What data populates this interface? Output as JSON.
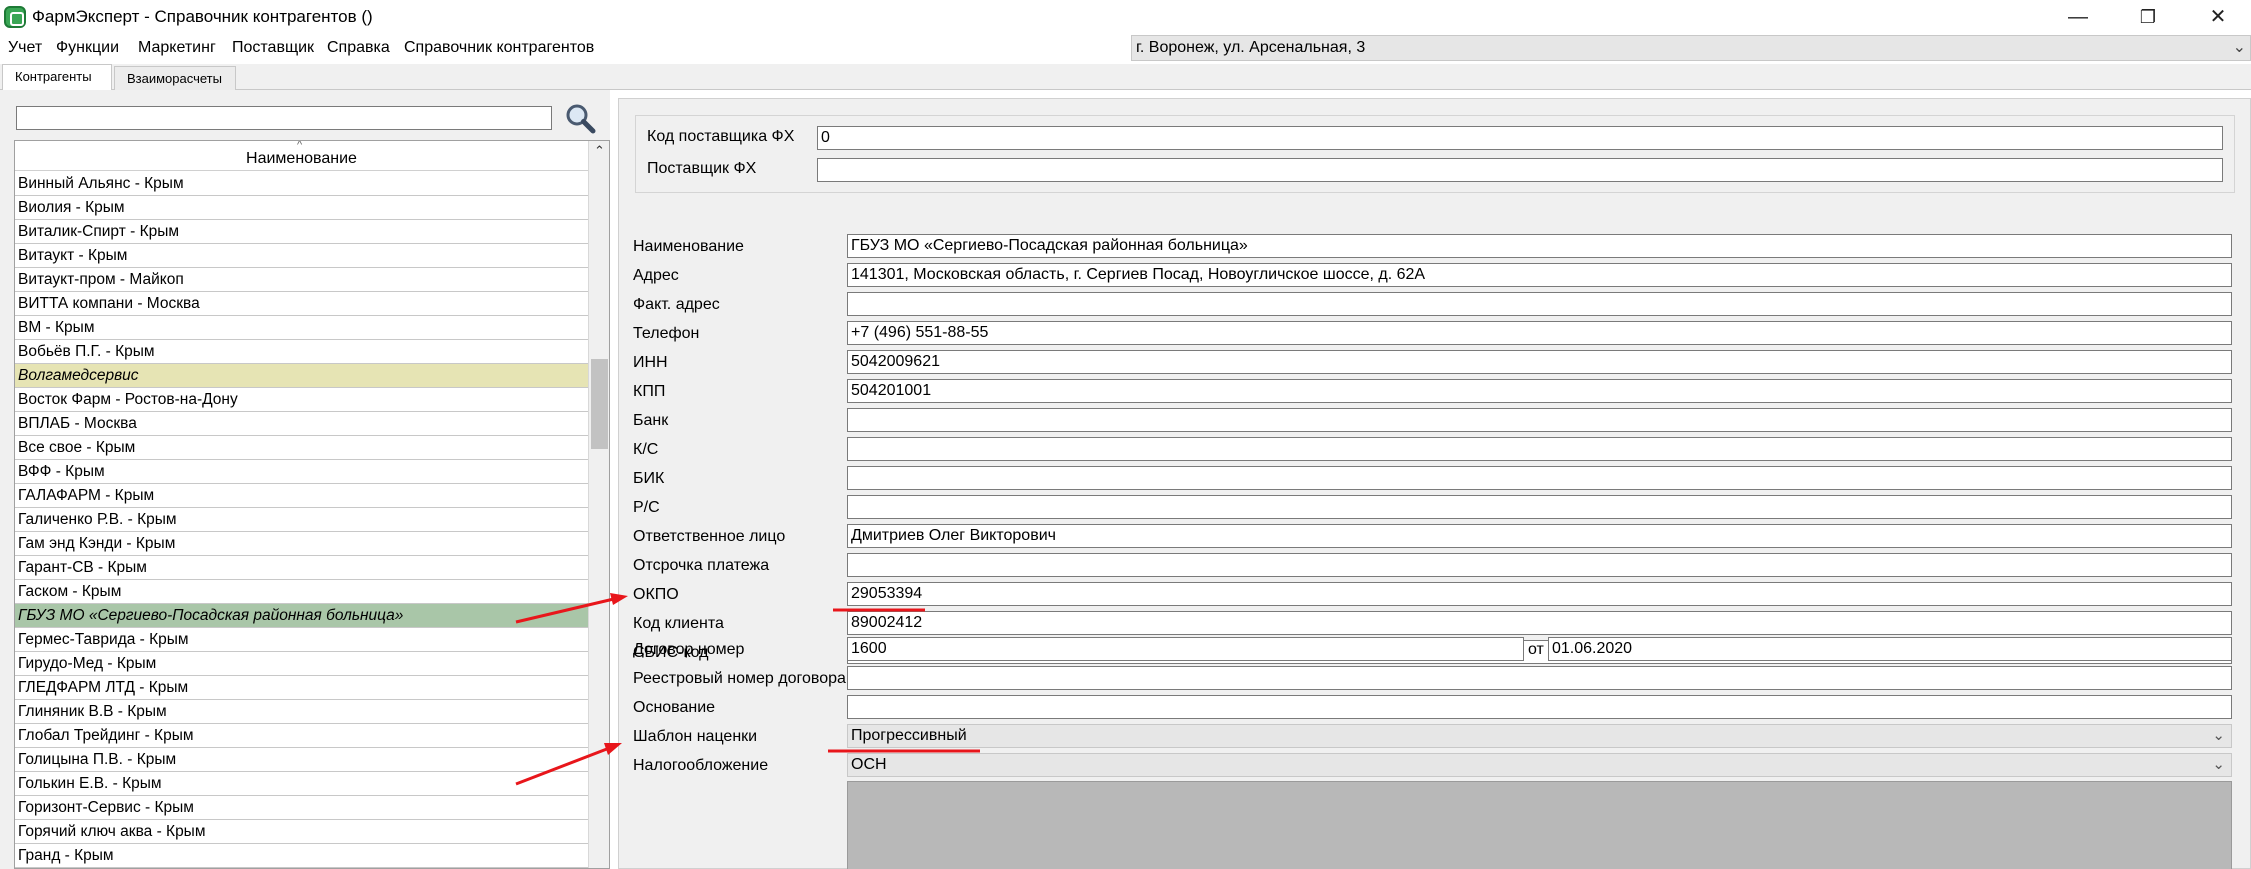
{
  "window": {
    "title": "ФармЭксперт - Справочник контрагентов ()",
    "minimize": "—",
    "restore": "❐",
    "close": "✕"
  },
  "menu": {
    "items": [
      "Учет",
      "Функции",
      "Маркетинг",
      "Поставщик",
      "Справка",
      "Справочник контрагентов"
    ],
    "location": "г. Воронеж, ул. Арсенальная, 3"
  },
  "tabs": [
    "Контрагенты",
    "Взаиморасчеты"
  ],
  "search": {
    "value": "",
    "placeholder": ""
  },
  "list": {
    "header": "Наименование",
    "rows": [
      "Винный Альянс - Крым",
      "Виолия - Крым",
      "Виталик-Спирт - Крым",
      "Витаукт - Крым",
      "Витаукт-пром - Майкоп",
      "ВИТТА компани - Москва",
      "ВМ - Крым",
      "Вобьёв П.Г. - Крым",
      "Волгамедсервис",
      "Восток Фарм - Ростов-на-Дону",
      "ВПЛАБ - Москва",
      "Все свое - Крым",
      "ВФФ - Крым",
      "ГАЛАФАРМ - Крым",
      "Галиченко Р.В. - Крым",
      "Гам энд Кэнди - Крым",
      "Гарант-СВ - Крым",
      "Гаском - Крым",
      "ГБУЗ МО «Сергиево-Посадская районная больница»",
      "Гермес-Таврида - Крым",
      "Гирудо-Мед - Крым",
      "ГЛЕДФАРМ ЛТД - Крым",
      "Глиняник В.В - Крым",
      "Глобал Трейдинг - Крым",
      "Голицына П.В. - Крым",
      "Голькин Е.В. - Крым",
      "Горизонт-Сервис - Крым",
      "Горячий ключ аква - Крым",
      "Гранд - Крым"
    ],
    "group_row_index": 8,
    "selected_row_index": 18
  },
  "form": {
    "fx_code_label": "Код поставщика ФХ",
    "fx_code_value": "0",
    "fx_supplier_label": "Поставщик ФХ",
    "fx_supplier_value": "",
    "fields": [
      {
        "label": "Наименование",
        "value": "ГБУЗ МО «Сергиево-Посадская районная больница»"
      },
      {
        "label": "Адрес",
        "value": "141301, Московская область, г. Сергиев Посад, Новоугличское шоссе, д. 62А"
      },
      {
        "label": "Факт. адрес",
        "value": ""
      },
      {
        "label": "Телефон",
        "value": "+7 (496) 551-88-55"
      },
      {
        "label": "ИНН",
        "value": "5042009621"
      },
      {
        "label": "КПП",
        "value": "504201001"
      },
      {
        "label": "Банк",
        "value": ""
      },
      {
        "label": "К/С",
        "value": ""
      },
      {
        "label": "БИК",
        "value": ""
      },
      {
        "label": "Р/С",
        "value": ""
      },
      {
        "label": "Ответственное лицо",
        "value": "Дмитриев Олег Викторович"
      },
      {
        "label": "Отсрочка платежа",
        "value": ""
      },
      {
        "label": "ОКПО",
        "value": "29053394"
      },
      {
        "label": "Код клиента",
        "value": "89002412"
      },
      {
        "label": "СБИС-код",
        "value": ""
      }
    ],
    "contract_label": "Договор номер",
    "contract_value": "1600",
    "contract_from_label": "от",
    "contract_date": "01.06.2020",
    "registry_label": "Реестровый номер договора",
    "registry_value": "",
    "basis_label": "Основание",
    "basis_value": "",
    "markup_label": "Шаблон наценки",
    "markup_value": "Прогрессивный",
    "tax_label": "Налогообложение",
    "tax_value": "ОСН"
  },
  "colors": {
    "group_row": "#e6e4b4",
    "selected_row": "#a9c6a8",
    "annotation": "#e8161b"
  }
}
